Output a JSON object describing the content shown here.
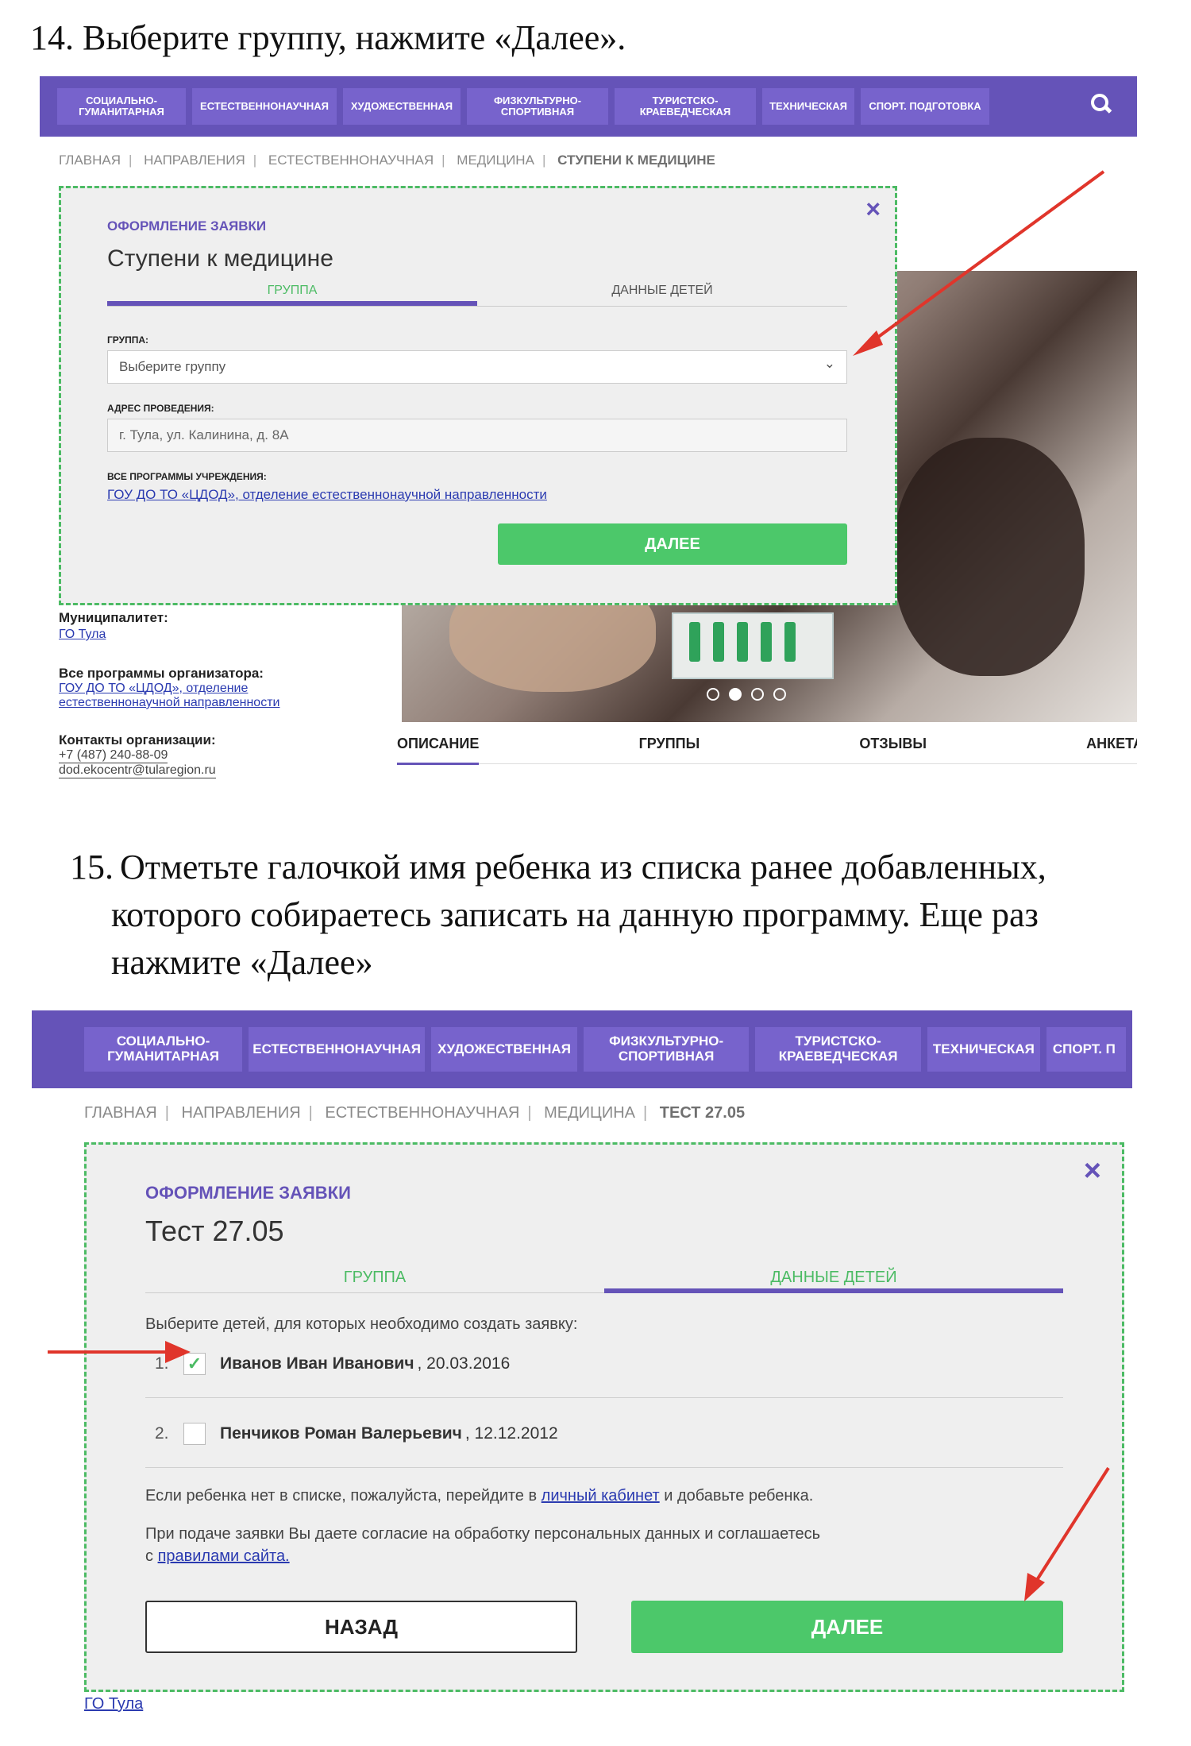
{
  "step14": {
    "number": "14.",
    "text": "Выберите группу, нажмите «Далее»."
  },
  "step15": {
    "number": "15.",
    "line1": "Отметьте галочкой имя ребенка из списка ранее добавленных,",
    "line2": "которого собираетесь записать на данную программу. Еще раз",
    "line3": "нажмите «Далее»"
  },
  "nav1": {
    "items": [
      "СОЦИАЛЬНО-ГУМАНИТАРНАЯ",
      "ЕСТЕСТВЕННОНАУЧНАЯ",
      "ХУДОЖЕСТВЕННАЯ",
      "ФИЗКУЛЬТУРНО-СПОРТИВНАЯ",
      "ТУРИСТСКО-КРАЕВЕДЧЕСКАЯ",
      "ТЕХНИЧЕСКАЯ",
      "СПОРТ. ПОДГОТОВКА"
    ],
    "search_icon": "search-icon"
  },
  "crumbs1": [
    "ГЛАВНАЯ",
    "НАПРАВЛЕНИЯ",
    "ЕСТЕСТВЕННОНАУЧНАЯ",
    "МЕДИЦИНА",
    "СТУПЕНИ К МЕДИЦИНЕ"
  ],
  "modal1": {
    "kicker": "ОФОРМЛЕНИЕ ЗАЯВКИ",
    "title": "Ступени к медицине",
    "tab_group": "ГРУППА",
    "tab_children": "ДАННЫЕ ДЕТЕЙ",
    "group_label": "ГРУППА:",
    "group_placeholder": "Выберите группу",
    "address_label": "АДРЕС ПРОВЕДЕНИЯ:",
    "address_value": "г. Тула, ул. Калинина, д. 8А",
    "programs_label": "ВСЕ ПРОГРАММЫ УЧРЕЖДЕНИЯ:",
    "programs_link": "ГОУ ДО ТО «ЦДОД», отделение естественнонаучной направленности",
    "next_button": "ДАЛЕЕ",
    "close": "×"
  },
  "page1": {
    "municipality_label": "Муниципалитет:",
    "municipality_link": "ГО Тула",
    "all_programs_label": "Все программы организатора:",
    "all_programs_link1": "ГОУ ДО ТО «ЦДОД», отделение",
    "all_programs_link2": "естественнонаучной направленности",
    "contacts_label": "Контакты организации:",
    "phone": "+7 (487) 240-88-09",
    "email": "dod.ekocentr@tularegion.ru",
    "tabs": [
      "ОПИСАНИЕ",
      "ГРУППЫ",
      "ОТЗЫВЫ",
      "АНКЕТА"
    ],
    "carousel_active_index": 1
  },
  "nav2": {
    "items": [
      "СОЦИАЛЬНО-ГУМАНИТАРНАЯ",
      "ЕСТЕСТВЕННОНАУЧНАЯ",
      "ХУДОЖЕСТВЕННАЯ",
      "ФИЗКУЛЬТУРНО-СПОРТИВНАЯ",
      "ТУРИСТСКО-КРАЕВЕДЧЕСКАЯ",
      "ТЕХНИЧЕСКАЯ",
      "СПОРТ. П"
    ]
  },
  "crumbs2": [
    "ГЛАВНАЯ",
    "НАПРАВЛЕНИЯ",
    "ЕСТЕСТВЕННОНАУЧНАЯ",
    "МЕДИЦИНА",
    "ТЕСТ 27.05"
  ],
  "modal2": {
    "kicker": "ОФОРМЛЕНИЕ ЗАЯВКИ",
    "title": "Тест 27.05",
    "tab_group": "ГРУППА",
    "tab_children": "ДАННЫЕ ДЕТЕЙ",
    "prompt": "Выберите детей, для которых необходимо создать заявку:",
    "children": [
      {
        "num": "1.",
        "name": "Иванов Иван Иванович",
        "date": ", 20.03.2016",
        "checked": true
      },
      {
        "num": "2.",
        "name": "Пенчиков Роман Валерьевич",
        "date": ", 12.12.2012",
        "checked": false
      }
    ],
    "note1_pre": "Если ребенка нет в списке, пожалуйста, перейдите в ",
    "note1_link": "личный кабинет",
    "note1_post": " и добавьте ребенка.",
    "note2_line1": "При подаче заявки Вы даете согласие на обработку персональных данных и соглашаетесь",
    "note2_pre": "с ",
    "note2_link": "правилами сайта.",
    "back_button": "НАЗАД",
    "next_button": "ДАЛЕЕ",
    "close": "×"
  },
  "page2": {
    "municipality_link": "ГО Тула"
  },
  "colors": {
    "nav": "#6553b8",
    "accent_green": "#4cc86a",
    "arrow_red": "#e0352b",
    "dashed_border": "#4cbb64"
  }
}
